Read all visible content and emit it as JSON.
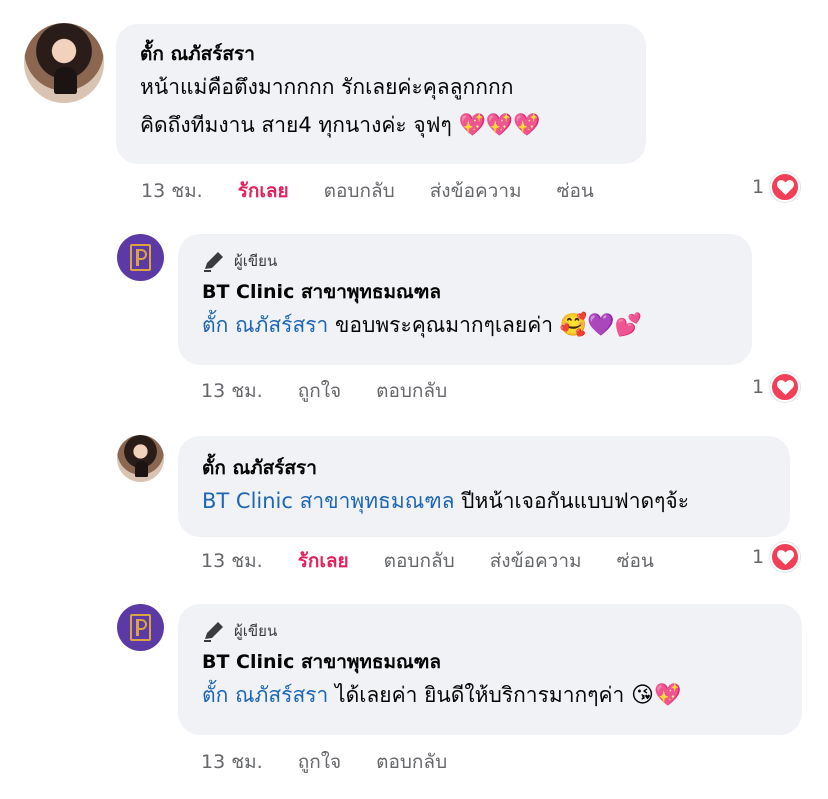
{
  "comments": [
    {
      "author": "ตั้ก ณภัสร์สรา",
      "lines": [
        "หน้าแม่คือตึงมากกกก รักเลยค่ะคุลลูกกกก",
        "คิดถึงทีมงาน สาย4 ทุกนางค่ะ จุฟๆ"
      ],
      "emoji": "💖💖💖",
      "time": "13 ชม.",
      "actions": [
        "รักเลย",
        "ตอบกลับ",
        "ส่งข้อความ",
        "ซ่อน"
      ],
      "reaction_count": "1"
    },
    {
      "badge": "ผู้เขียน",
      "author": "BT Clinic สาขาพุทธมณฑล",
      "mention": "ตั้ก ณภัสร์สรา",
      "text": " ขอบพระคุณมากๆเลยค่า",
      "emoji": "🥰💜💕",
      "time": "13 ชม.",
      "actions": [
        "ถูกใจ",
        "ตอบกลับ"
      ],
      "reaction_count": "1"
    },
    {
      "author": "ตั้ก ณภัสร์สรา",
      "mention": "BT Clinic สาขาพุทธมณฑล",
      "text": " ปีหน้าเจอกันแบบฟาดๆจ้ะ",
      "time": "13 ชม.",
      "actions": [
        "รักเลย",
        "ตอบกลับ",
        "ส่งข้อความ",
        "ซ่อน"
      ],
      "reaction_count": "1"
    },
    {
      "badge": "ผู้เขียน",
      "author": "BT Clinic สาขาพุทธมณฑล",
      "mention": "ตั้ก ณภัสร์สรา",
      "text": " ได้เลยค่า ยินดีให้บริการมากๆค่า",
      "emoji": "😘💖",
      "time": "13 ชม.",
      "actions": [
        "ถูกใจ",
        "ตอบกลับ"
      ]
    }
  ],
  "colors": {
    "bubble": "#f0f2f5",
    "mention": "#1d66b6",
    "liked": "#e0245e",
    "heart": "#f33e58"
  },
  "icons": {
    "author_badge": "pen-icon",
    "reaction": "heart-icon"
  }
}
